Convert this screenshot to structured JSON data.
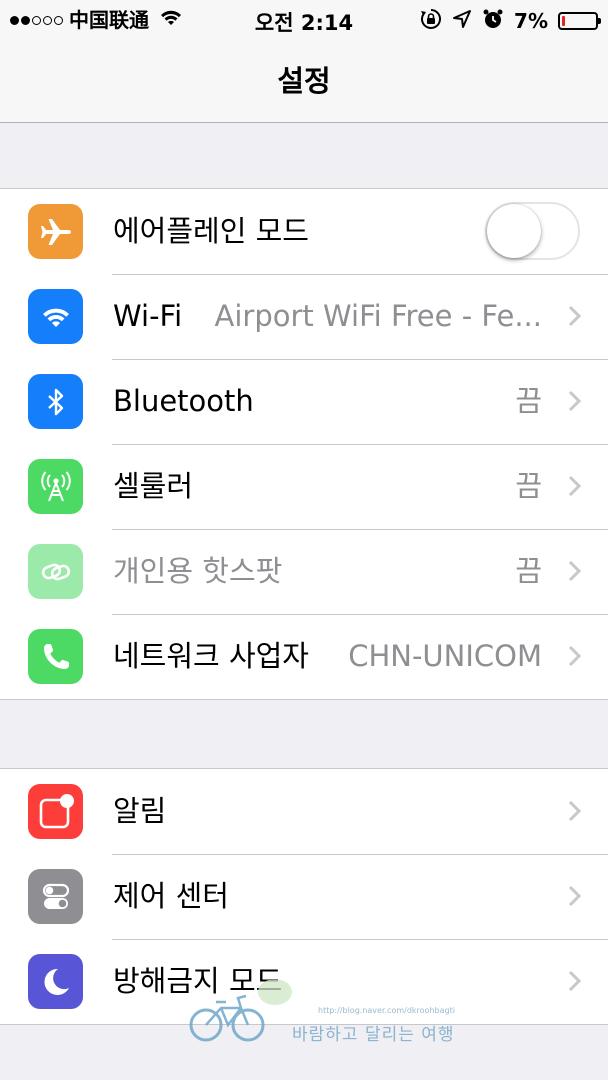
{
  "status_bar": {
    "signal_dots_filled": 2,
    "signal_dots_total": 5,
    "carrier": "中国联通",
    "time": "오전 2:14",
    "battery_percent": "7%",
    "battery_level": 0.07,
    "icons": [
      "wifi-icon",
      "rotation-lock-icon",
      "location-arrow-icon",
      "alarm-icon",
      "battery-icon"
    ]
  },
  "nav": {
    "title": "설정"
  },
  "groups": [
    {
      "rows": [
        {
          "label": "에어플레인 모드",
          "icon": "airplane-icon",
          "icon_color": "#f09a37",
          "toggle": false
        },
        {
          "label": "Wi-Fi",
          "value": "Airport WiFi Free - Fe...",
          "icon": "wifi-icon",
          "icon_color": "#147efb"
        },
        {
          "label": "Bluetooth",
          "value": "끔",
          "icon": "bluetooth-icon",
          "icon_color": "#147efb"
        },
        {
          "label": "셀룰러",
          "value": "끔",
          "icon": "cellular-antenna-icon",
          "icon_color": "#4cd964"
        },
        {
          "label": "개인용 핫스팟",
          "value": "끔",
          "icon": "hotspot-link-icon",
          "icon_color": "#4cd964",
          "disabled": true
        },
        {
          "label": "네트워크 사업자",
          "value": "CHN-UNICOM",
          "icon": "phone-icon",
          "icon_color": "#4cd964"
        }
      ]
    },
    {
      "rows": [
        {
          "label": "알림",
          "icon": "notifications-icon",
          "icon_color": "#fc3d39"
        },
        {
          "label": "제어 센터",
          "icon": "control-center-icon",
          "icon_color": "#8e8e93"
        },
        {
          "label": "방해금지 모드",
          "icon": "moon-icon",
          "icon_color": "#5856d6"
        }
      ]
    }
  ],
  "watermark": {
    "text": "바람하고 달리는 여행",
    "url": "http://blog.naver.com/dkroohbagti"
  }
}
